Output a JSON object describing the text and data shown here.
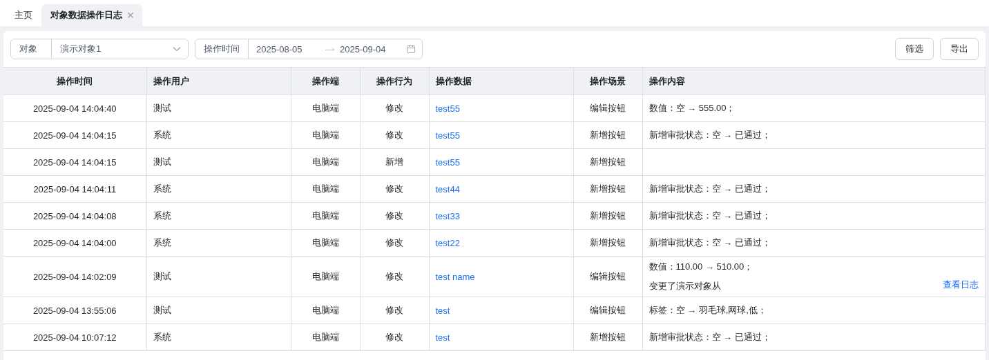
{
  "tabs": [
    {
      "label": "主页",
      "selected": false
    },
    {
      "label": "对象数据操作日志",
      "selected": true
    }
  ],
  "filters": {
    "object": {
      "label": "对象",
      "value": "演示对象1"
    },
    "time": {
      "label": "操作时间",
      "start": "2025-08-05",
      "end": "2025-09-04"
    },
    "buttons": [
      "筛选",
      "导出"
    ]
  },
  "table": {
    "columns": [
      "操作时间",
      "操作用户",
      "操作端",
      "操作行为",
      "操作数据",
      "操作场景",
      "操作内容"
    ],
    "rows": [
      {
        "time": "2025-09-04 14:04:40",
        "user": "测试",
        "client": "电脑端",
        "action": "修改",
        "data": "test55",
        "scene": "编辑按钮",
        "content": [
          "数值：空 → 555.00；"
        ]
      },
      {
        "time": "2025-09-04 14:04:15",
        "user": "系统",
        "client": "电脑端",
        "action": "修改",
        "data": "test55",
        "scene": "新增按钮",
        "content": [
          "新增审批状态：空 → 已通过；"
        ]
      },
      {
        "time": "2025-09-04 14:04:15",
        "user": "测试",
        "client": "电脑端",
        "action": "新增",
        "data": "test55",
        "scene": "新增按钮",
        "content": []
      },
      {
        "time": "2025-09-04 14:04:11",
        "user": "系统",
        "client": "电脑端",
        "action": "修改",
        "data": "test44",
        "scene": "新增按钮",
        "content": [
          "新增审批状态：空 → 已通过；"
        ]
      },
      {
        "time": "2025-09-04 14:04:08",
        "user": "系统",
        "client": "电脑端",
        "action": "修改",
        "data": "test33",
        "scene": "新增按钮",
        "content": [
          "新增审批状态：空 → 已通过；"
        ]
      },
      {
        "time": "2025-09-04 14:04:00",
        "user": "系统",
        "client": "电脑端",
        "action": "修改",
        "data": "test22",
        "scene": "新增按钮",
        "content": [
          "新增审批状态：空 → 已通过；"
        ]
      },
      {
        "time": "2025-09-04 14:02:09",
        "user": "测试",
        "client": "电脑端",
        "action": "修改",
        "data": "test name",
        "scene": "编辑按钮",
        "content": [
          "数值：110.00 → 510.00；",
          "变更了演示对象从"
        ],
        "log_link": "查看日志"
      },
      {
        "time": "2025-09-04 13:55:06",
        "user": "测试",
        "client": "电脑端",
        "action": "修改",
        "data": "test",
        "scene": "编辑按钮",
        "content": [
          "标签：空 → 羽毛球,网球,低；"
        ]
      },
      {
        "time": "2025-09-04 10:07:12",
        "user": "系统",
        "client": "电脑端",
        "action": "修改",
        "data": "test",
        "scene": "新增按钮",
        "content": [
          "新增审批状态：空 → 已通过；"
        ]
      }
    ]
  }
}
